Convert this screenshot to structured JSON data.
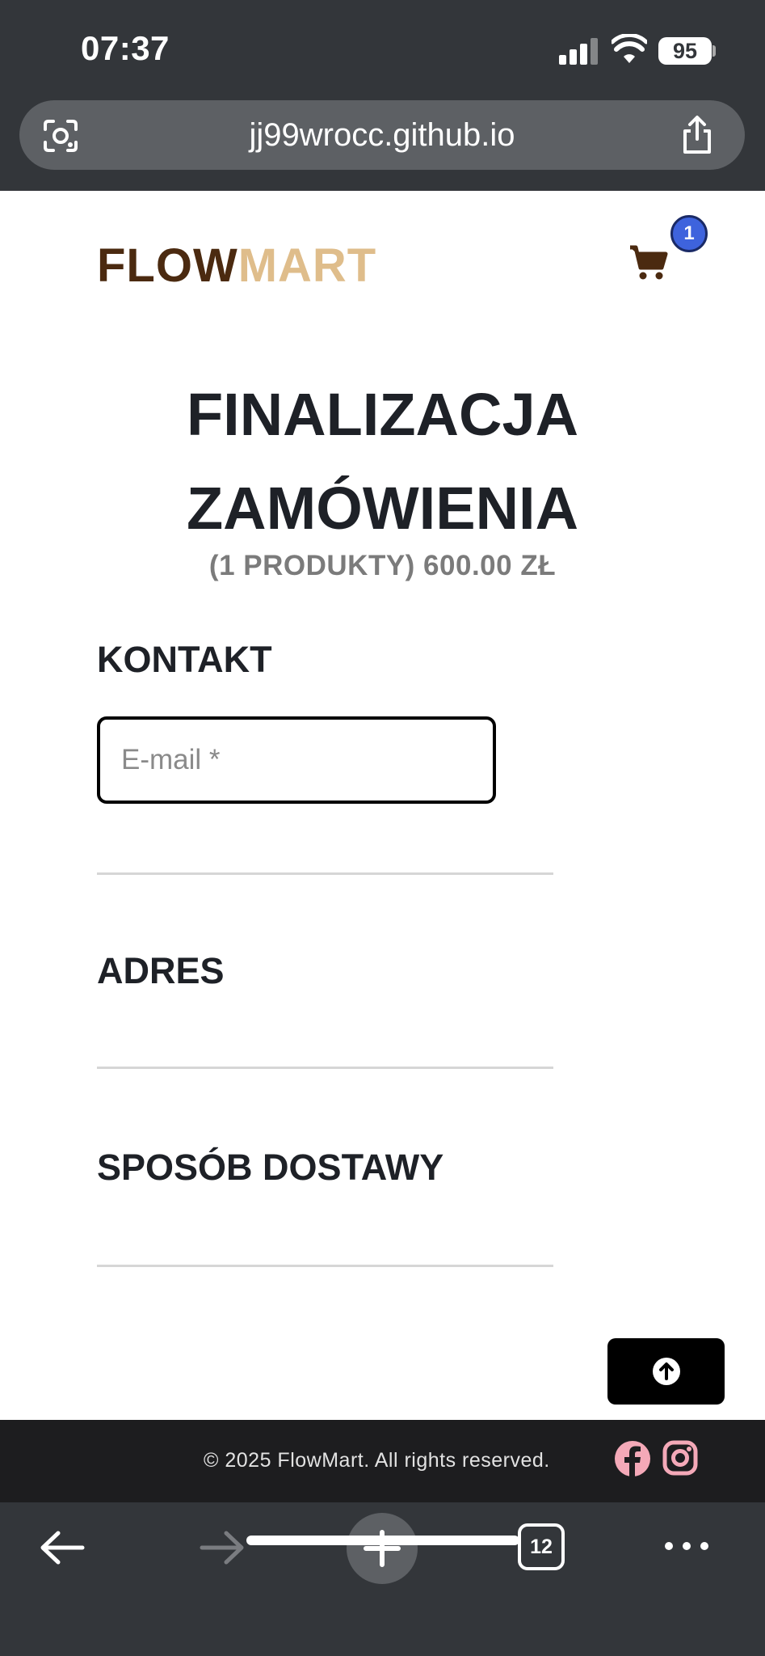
{
  "status_bar": {
    "time": "07:37",
    "battery": "95"
  },
  "browser": {
    "url": "jj99wrocc.github.io",
    "tab_count": "12"
  },
  "header": {
    "logo_part1": "FLOW",
    "logo_part2": "MART",
    "cart_count": "1"
  },
  "checkout": {
    "title_line1": "FINALIZACJA",
    "title_line2": "ZAMÓWIENIA",
    "summary": "(1 PRODUKTY) 600.00 ZŁ",
    "contact_heading": "KONTAKT",
    "email_placeholder": "E-mail *",
    "address_heading": "ADRES",
    "delivery_heading": "SPOSÓB DOSTAWY"
  },
  "footer": {
    "copyright": "© 2025 FlowMart. All rights reserved."
  },
  "icons": [
    "lens-icon",
    "share-icon",
    "cart-icon",
    "arrow-up-icon",
    "facebook-icon",
    "instagram-icon",
    "back-arrow-icon",
    "forward-arrow-icon",
    "plus-icon",
    "more-icon"
  ],
  "colors": {
    "logo_dark": "#4b2a10",
    "logo_light": "#dfbd8b",
    "badge": "#3e63dd",
    "social_pink": "#f4a9b8",
    "chrome": "#33363a"
  }
}
